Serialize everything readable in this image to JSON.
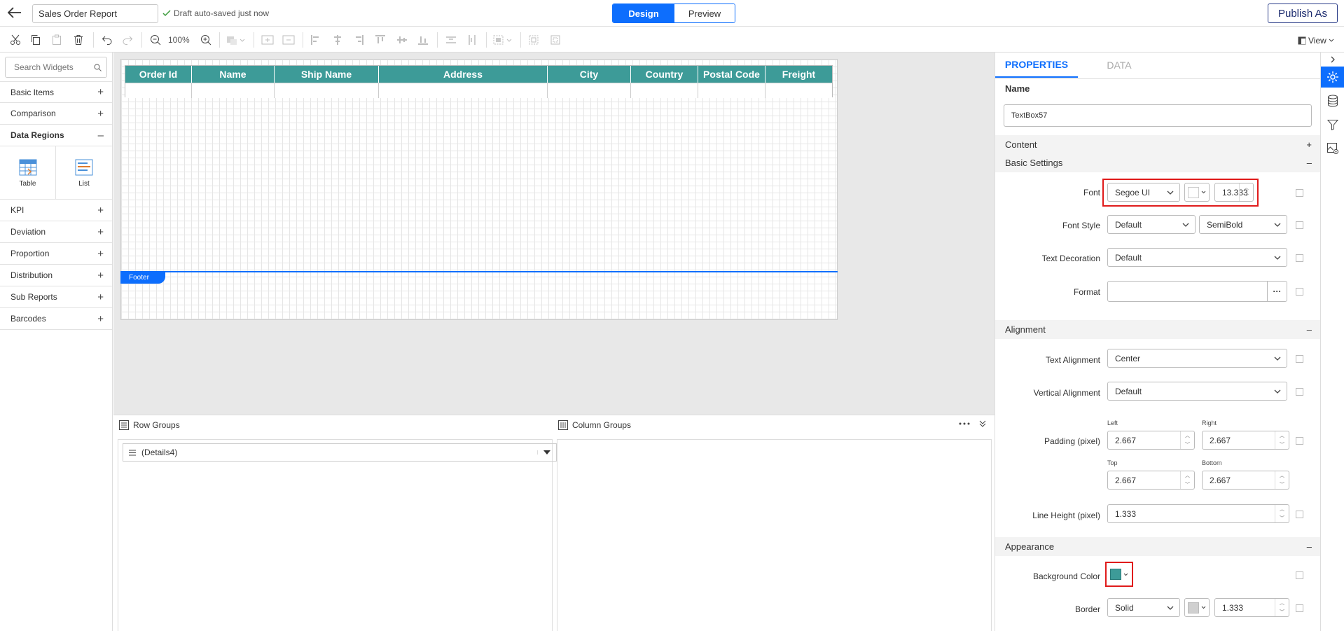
{
  "header": {
    "report_name": "Sales Order Report",
    "autosave_text": "Draft auto-saved just now",
    "design_label": "Design",
    "preview_label": "Preview",
    "publish_label": "Publish As"
  },
  "toolbar": {
    "zoom": "100%",
    "view_label": "View"
  },
  "sidebar": {
    "search_placeholder": "Search Widgets",
    "categories": [
      {
        "label": "Basic Items",
        "state": "+"
      },
      {
        "label": "Comparison",
        "state": "+"
      },
      {
        "label": "Data Regions",
        "state": "–"
      },
      {
        "label": "KPI",
        "state": "+"
      },
      {
        "label": "Deviation",
        "state": "+"
      },
      {
        "label": "Proportion",
        "state": "+"
      },
      {
        "label": "Distribution",
        "state": "+"
      },
      {
        "label": "Sub Reports",
        "state": "+"
      },
      {
        "label": "Barcodes",
        "state": "+"
      }
    ],
    "data_region_items": [
      "Table",
      "List"
    ]
  },
  "report": {
    "columns": [
      "Order Id",
      "Name",
      "Ship Name",
      "Address",
      "City",
      "Country",
      "Postal Code",
      "Freight"
    ],
    "header_color": "#3d9b98",
    "footer_label": "Footer"
  },
  "groups": {
    "row_groups_label": "Row Groups",
    "column_groups_label": "Column Groups",
    "row_item": "(Details4)"
  },
  "properties": {
    "tabs": [
      "PROPERTIES",
      "DATA"
    ],
    "name_label": "Name",
    "name_value": "TextBox57",
    "sections": {
      "content": "Content",
      "basic_settings": "Basic Settings",
      "alignment": "Alignment",
      "appearance": "Appearance"
    },
    "font": {
      "label": "Font",
      "family": "Segoe UI",
      "size": "13.333"
    },
    "font_style": {
      "label": "Font Style",
      "style": "Default",
      "weight": "SemiBold"
    },
    "text_decoration": {
      "label": "Text Decoration",
      "value": "Default"
    },
    "format": {
      "label": "Format",
      "value": ""
    },
    "text_alignment": {
      "label": "Text Alignment",
      "value": "Center"
    },
    "vertical_alignment": {
      "label": "Vertical Alignment",
      "value": "Default"
    },
    "padding": {
      "label": "Padding (pixel)",
      "left_label": "Left",
      "left": "2.667",
      "right_label": "Right",
      "right": "2.667",
      "top_label": "Top",
      "top": "2.667",
      "bottom_label": "Bottom",
      "bottom": "2.667"
    },
    "line_height": {
      "label": "Line Height (pixel)",
      "value": "1.333"
    },
    "background_color": {
      "label": "Background Color",
      "color": "#3d9b98"
    },
    "border": {
      "label": "Border",
      "style": "Solid",
      "width": "1.333"
    }
  }
}
